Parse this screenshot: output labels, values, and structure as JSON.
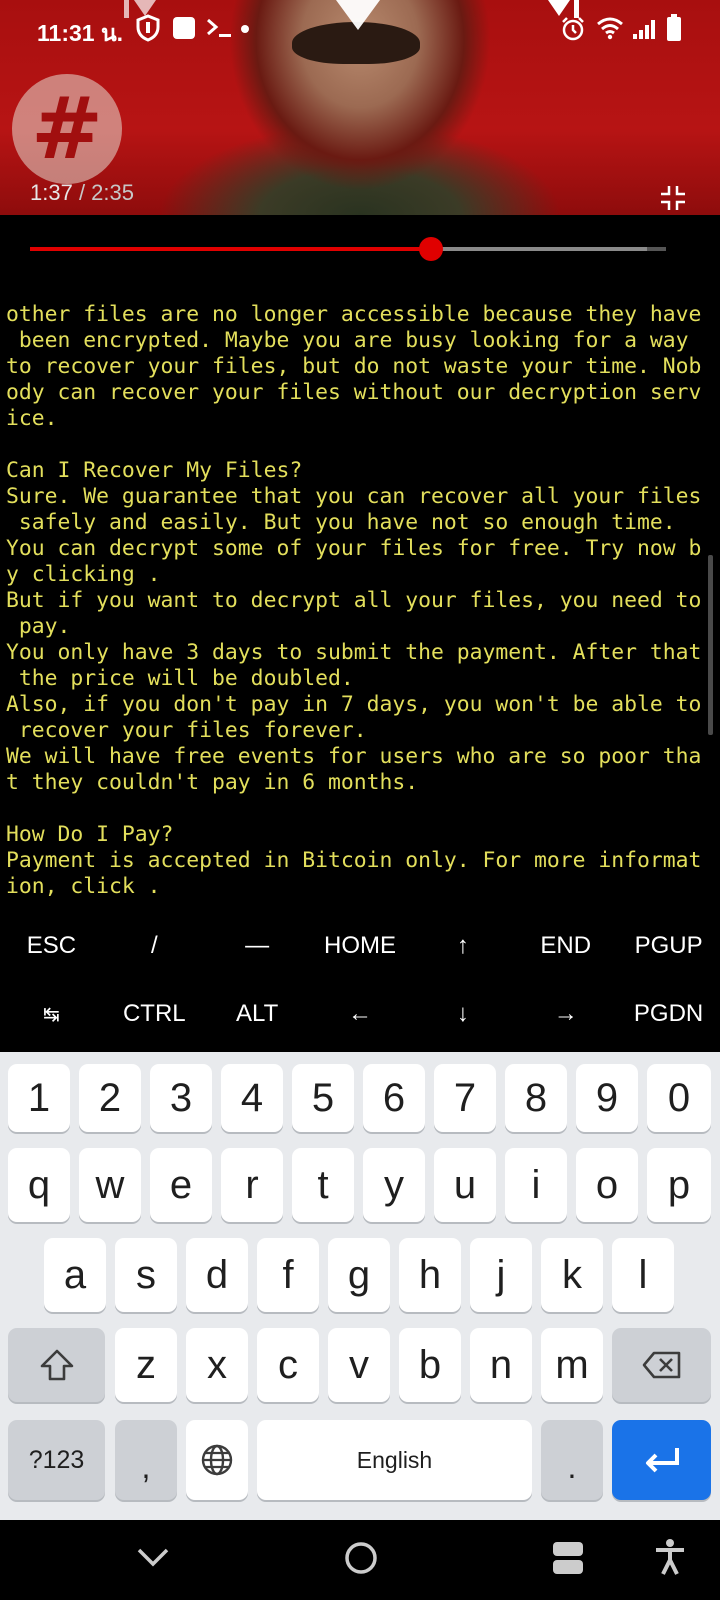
{
  "status_bar": {
    "time": "11:31 น."
  },
  "video": {
    "current_time": "1:37",
    "total_time": "2:35",
    "progress": 0.63,
    "buffered": 0.97,
    "logo_glyph": "#"
  },
  "terminal": {
    "lines": [
      "other files are no longer accessible because they have",
      " been encrypted. Maybe you are busy looking for a way",
      "to recover your files, but do not waste your time. Nob",
      "ody can recover your files without our decryption serv",
      "ice.",
      "",
      "Can I Recover My Files?",
      "Sure. We guarantee that you can recover all your files",
      " safely and easily. But you have not so enough time.",
      "You can decrypt some of your files for free. Try now b",
      "y clicking .",
      "But if you want to decrypt all your files, you need to",
      " pay.",
      "You only have 3 days to submit the payment. After that",
      " the price will be doubled.",
      "Also, if you don't pay in 7 days, you won't be able to",
      " recover your files forever.",
      "We will have free events for users who are so poor tha",
      "t they couldn't pay in 6 months.",
      "",
      "How Do I Pay?",
      "Payment is accepted in Bitcoin only. For more informat",
      "ion, click ."
    ],
    "text_color": "#e3df5c"
  },
  "extra_keys": {
    "row1": [
      "ESC",
      "/",
      "—",
      "HOME",
      "↑",
      "END",
      "PGUP"
    ],
    "row2": [
      "↹",
      "CTRL",
      "ALT",
      "←",
      "↓",
      "→",
      "PGDN"
    ]
  },
  "keyboard": {
    "numbers": [
      "1",
      "2",
      "3",
      "4",
      "5",
      "6",
      "7",
      "8",
      "9",
      "0"
    ],
    "row1": [
      "q",
      "w",
      "e",
      "r",
      "t",
      "y",
      "u",
      "i",
      "o",
      "p"
    ],
    "row2": [
      "a",
      "s",
      "d",
      "f",
      "g",
      "h",
      "j",
      "k",
      "l"
    ],
    "row3": [
      "z",
      "x",
      "c",
      "v",
      "b",
      "n",
      "m"
    ],
    "symbols_label": "?123",
    "comma_label": ",",
    "space_label": "English",
    "period_label": ".",
    "icons": {
      "shift": "shift-icon",
      "backspace": "backspace-icon",
      "globe": "globe-icon",
      "enter": "enter-icon"
    },
    "accent_color": "#1a73e8"
  },
  "nav_bar": {
    "icons": [
      "chevron-down-icon",
      "home-circle-icon",
      "recents-icon",
      "accessibility-icon"
    ]
  }
}
